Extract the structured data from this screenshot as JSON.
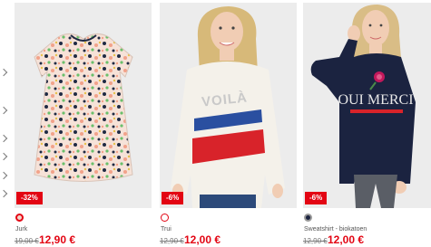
{
  "products": [
    {
      "name": "Jurk",
      "discount": "-32%",
      "old_price": "19,00 €",
      "new_price": "12,90 €",
      "swatch_color": "#f3d6cc",
      "swatch_ring": "#e30513",
      "image": "floral-dress-photo"
    },
    {
      "name": "Trui",
      "discount": "-6%",
      "old_price": "12,90 €",
      "new_price": "12,00 €",
      "swatch_color": "#ffffff",
      "swatch_ring": "#e30513",
      "image": "voila-sweater-photo",
      "print_text": "VOILÀ"
    },
    {
      "name": "Sweatshirt - biokatoen",
      "discount": "-6%",
      "old_price": "12,90 €",
      "new_price": "12,00 €",
      "swatch_color": "#1b2340",
      "swatch_ring": "#999999",
      "image": "oui-merci-sweatshirt-photo",
      "print_text": "OUI MERCI"
    }
  ],
  "colors": {
    "sale_red": "#e30513",
    "image_bg": "#ececec"
  }
}
